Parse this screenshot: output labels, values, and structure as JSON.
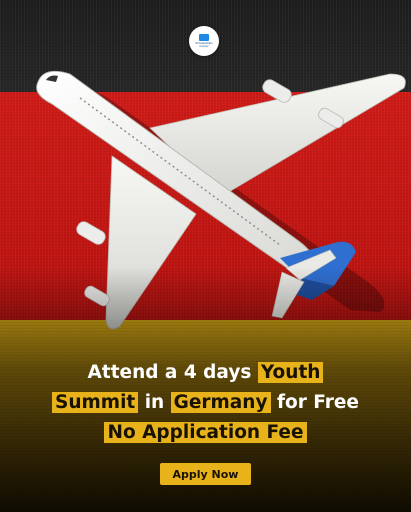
{
  "brand": {
    "logo_text": "Scholarships Corner",
    "icon": "graduation-cap-icon"
  },
  "headline": {
    "line1_pre": "Attend a 4 days",
    "line1_highlight": "Youth",
    "line2_highlight_a": "Summit",
    "line2_mid": "in",
    "line2_highlight_b": "Germany",
    "line2_post": "for Free",
    "line3_highlight": "No Application Fee"
  },
  "cta": {
    "label": "Apply Now"
  },
  "colors": {
    "flag_black": "#222222",
    "flag_red": "#c4160f",
    "flag_gold": "#d19b10",
    "highlight": "#e8b31a",
    "text": "#ffffff",
    "plane_body": "#f2f2ef",
    "plane_tail": "#2f6fd0"
  }
}
